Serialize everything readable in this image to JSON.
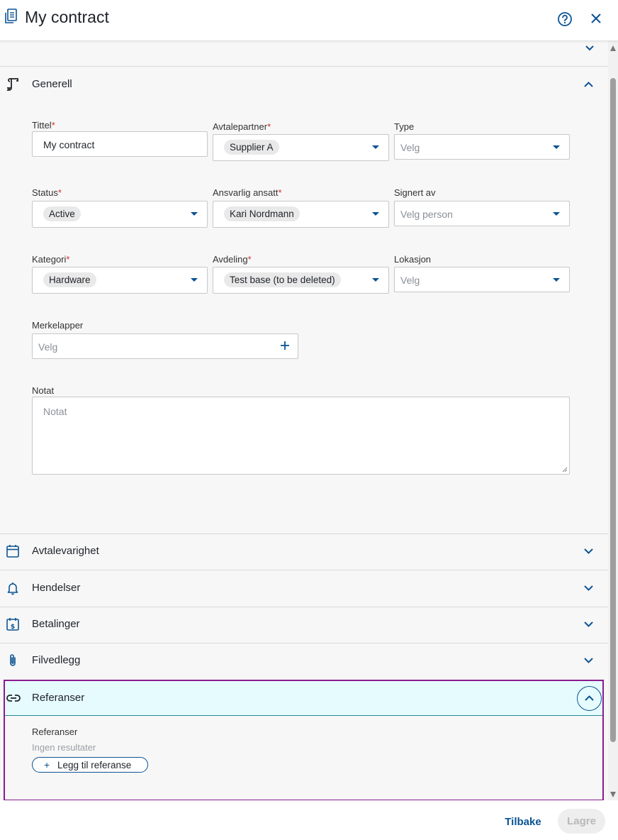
{
  "header": {
    "title": "My contract",
    "icons": [
      "document-icon",
      "help-icon",
      "close-icon"
    ]
  },
  "sections": {
    "general": {
      "label": "Generell"
    },
    "duration": {
      "label": "Avtalevarighet"
    },
    "events": {
      "label": "Hendelser"
    },
    "payments": {
      "label": "Betalinger"
    },
    "attachments": {
      "label": "Filvedlegg"
    },
    "references": {
      "label": "Referanser"
    }
  },
  "form": {
    "title": {
      "label": "Tittel",
      "required": "*",
      "value": "My contract"
    },
    "partner": {
      "label": "Avtalepartner",
      "required": "*",
      "value": "Supplier A"
    },
    "type": {
      "label": "Type",
      "placeholder": "Velg"
    },
    "status": {
      "label": "Status",
      "required": "*",
      "value": "Active"
    },
    "responsible": {
      "label": "Ansvarlig ansatt",
      "required": "*",
      "value": "Kari Nordmann"
    },
    "signed_by": {
      "label": "Signert av",
      "placeholder": "Velg person"
    },
    "category": {
      "label": "Kategori",
      "required": "*",
      "value": "Hardware"
    },
    "department": {
      "label": "Avdeling",
      "required": "*",
      "value": "Test base (to be deleted)"
    },
    "location": {
      "label": "Lokasjon",
      "placeholder": "Velg"
    },
    "tags": {
      "label": "Merkelapper",
      "placeholder": "Velg"
    },
    "note": {
      "label": "Notat",
      "placeholder": "Notat"
    }
  },
  "references": {
    "header_label": "Referanser",
    "list_label": "Referanser",
    "empty_text": "Ingen resultater",
    "add_plus": "+",
    "add_label": "Legg til referanse"
  },
  "footer": {
    "back_label": "Tilbake",
    "save_label": "Lagre"
  },
  "colors": {
    "accent": "#0b5394",
    "required": "#d0312d",
    "highlight_border": "#8b1a8f",
    "highlight_bg": "#e6fbfd"
  }
}
